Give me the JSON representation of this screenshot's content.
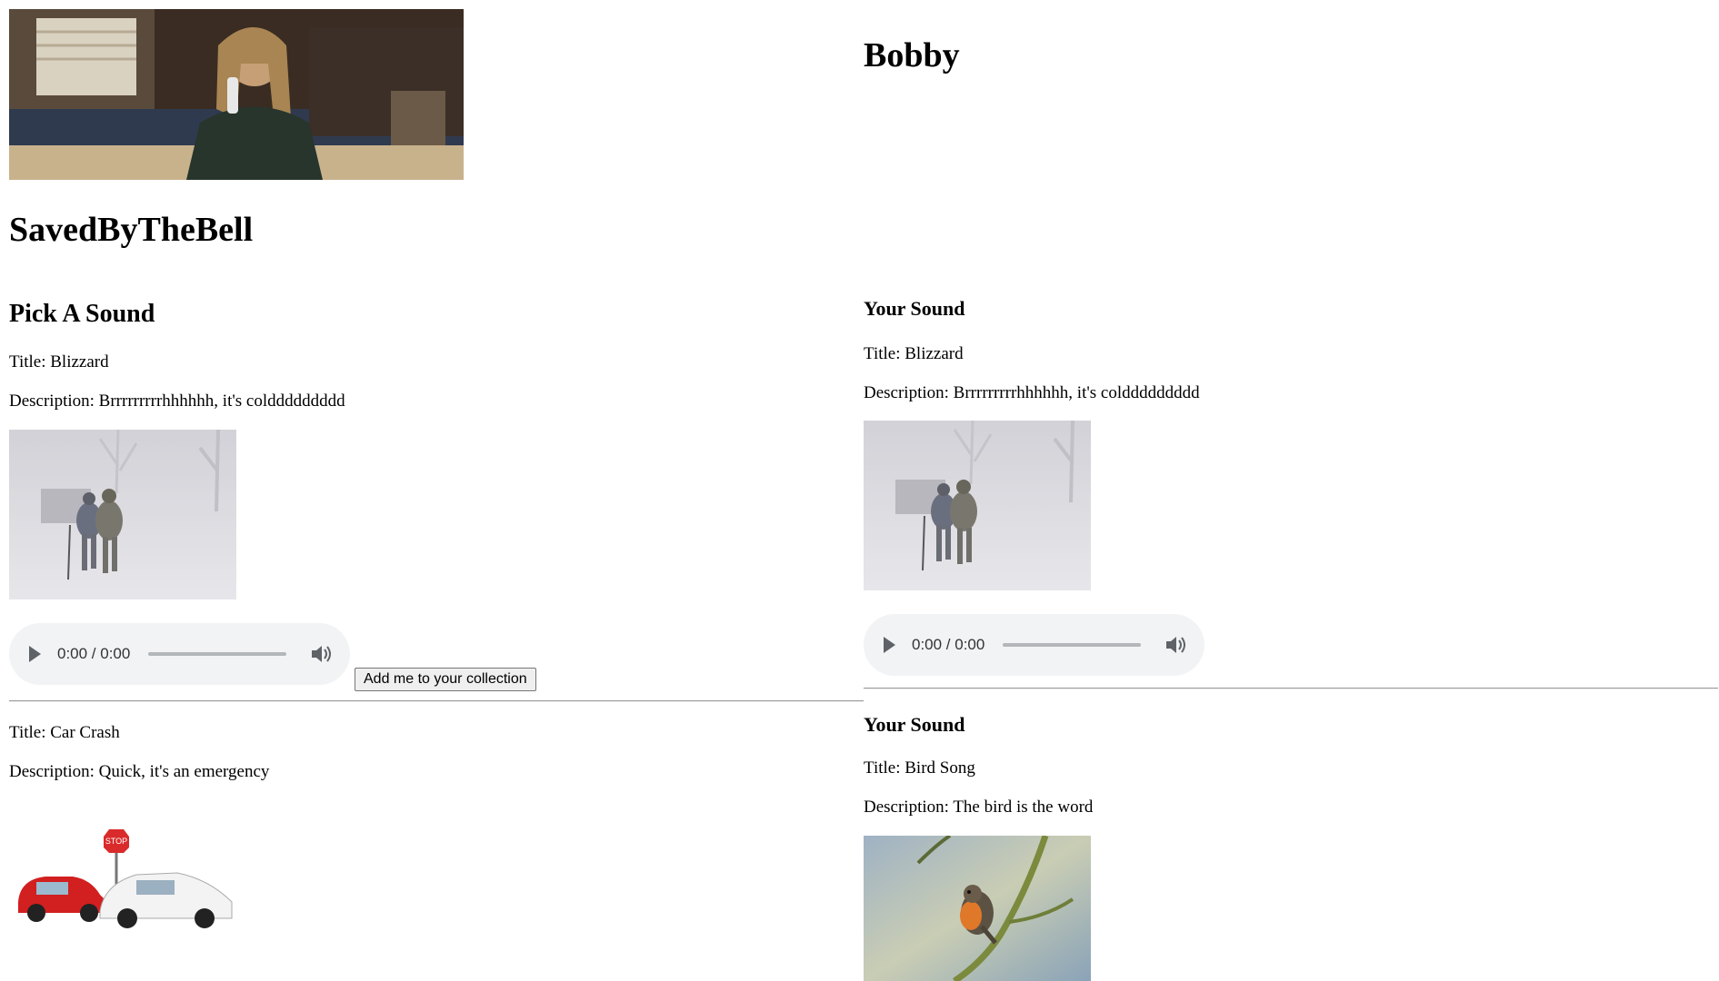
{
  "left": {
    "site_title": "SavedByTheBell",
    "section_heading": "Pick A Sound",
    "sounds": [
      {
        "title": "Title: Blizzard",
        "description": "Description: Brrrrrrrrrhhhhhh, it's colddddddddd",
        "image": "blizzard-photo",
        "audio_time": "0:00 / 0:00",
        "button": "Add me to your collection"
      },
      {
        "title": "Title: Car Crash",
        "description": "Description: Quick, it's an emergency",
        "image": "car-crash-illustration"
      }
    ]
  },
  "right": {
    "user_name": "Bobby",
    "collection": [
      {
        "heading": "Your Sound",
        "title": "Title: Blizzard",
        "description": "Description: Brrrrrrrrrhhhhhh, it's colddddddddd",
        "image": "blizzard-photo",
        "audio_time": "0:00 / 0:00"
      },
      {
        "heading": "Your Sound",
        "title": "Title: Bird Song",
        "description": "Description: The bird is the word",
        "image": "robin-photo"
      }
    ]
  },
  "icons": {
    "play": "play-icon",
    "volume": "volume-icon"
  },
  "colors": {
    "audio_bg": "#f1f3f4",
    "divider": "#9a9a9a"
  }
}
